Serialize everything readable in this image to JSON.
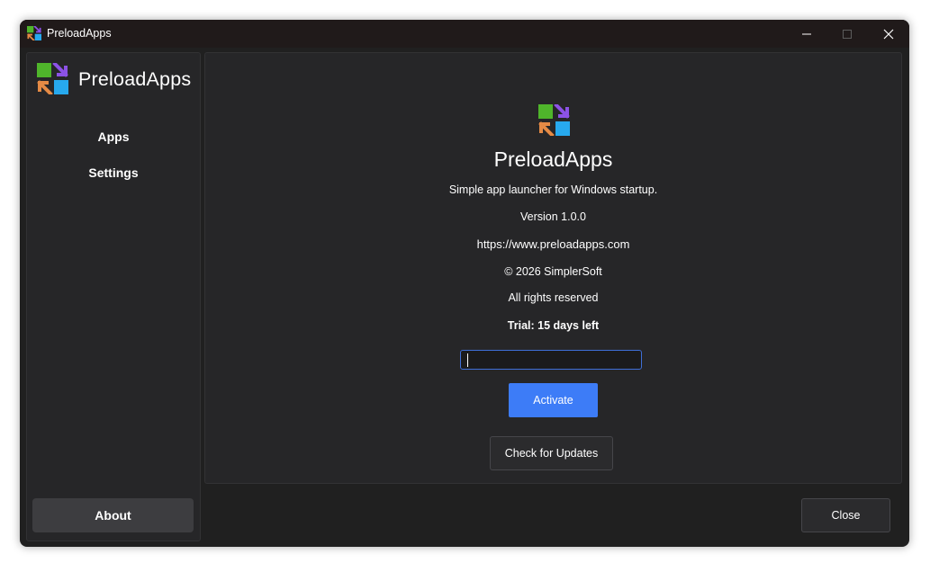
{
  "window": {
    "title": "PreloadApps",
    "controls": [
      "minimize-icon",
      "maximize-icon",
      "close-icon"
    ]
  },
  "sidebar": {
    "brand": "PreloadApps",
    "items": [
      {
        "label": "Apps"
      },
      {
        "label": "Settings"
      }
    ],
    "about_label": "About"
  },
  "about": {
    "product_name": "PreloadApps",
    "tagline": "Simple app launcher for Windows startup.",
    "version": "Version 1.0.0",
    "url": "https://www.preloadapps.com",
    "copyright": "© 2026 SimplerSoft",
    "rights": "All rights reserved",
    "trial": "Trial: 15 days left",
    "license_key": {
      "value": "",
      "placeholder": ""
    },
    "activate_label": "Activate",
    "check_updates_label": "Check for Updates"
  },
  "footer": {
    "close_label": "Close"
  },
  "colors": {
    "logo_green": "#4fb52b",
    "logo_purple": "#8c52e6",
    "logo_orange": "#e58a45",
    "logo_blue": "#27a9ee",
    "accent": "#3d7cf7"
  }
}
